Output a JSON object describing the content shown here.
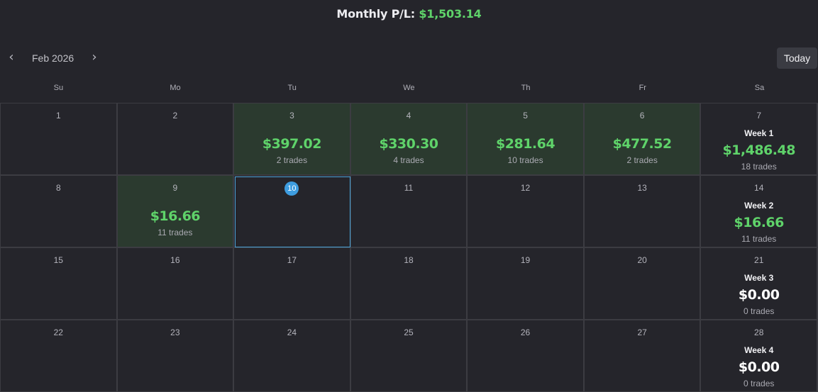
{
  "summary": {
    "label": "Monthly P/L:",
    "value": "$1,503.14"
  },
  "nav": {
    "month_label": "Feb 2026",
    "prev": "‹",
    "next": "›",
    "today_label": "Today"
  },
  "weekdays": [
    "Su",
    "Mo",
    "Tu",
    "We",
    "Th",
    "Fr",
    "Sa"
  ],
  "colors": {
    "profit_green": "#5fd36a",
    "profit_cell_bg": "#2b3a2f",
    "today_accent": "#3e9de0"
  },
  "days": [
    {
      "day": "1"
    },
    {
      "day": "2"
    },
    {
      "day": "3",
      "pnl": "$397.02",
      "trades": "2 trades"
    },
    {
      "day": "4",
      "pnl": "$330.30",
      "trades": "4 trades"
    },
    {
      "day": "5",
      "pnl": "$281.64",
      "trades": "10 trades"
    },
    {
      "day": "6",
      "pnl": "$477.52",
      "trades": "2 trades"
    },
    {
      "day": "7",
      "week": "Week 1",
      "week_pnl": "$1,486.48",
      "week_trades": "18 trades"
    },
    {
      "day": "8"
    },
    {
      "day": "9",
      "pnl": "$16.66",
      "trades": "11 trades"
    },
    {
      "day": "10",
      "today": true
    },
    {
      "day": "11"
    },
    {
      "day": "12"
    },
    {
      "day": "13"
    },
    {
      "day": "14",
      "week": "Week 2",
      "week_pnl": "$16.66",
      "week_trades": "11 trades"
    },
    {
      "day": "15"
    },
    {
      "day": "16"
    },
    {
      "day": "17"
    },
    {
      "day": "18"
    },
    {
      "day": "19"
    },
    {
      "day": "20"
    },
    {
      "day": "21",
      "week": "Week 3",
      "week_pnl": "$0.00",
      "week_trades": "0 trades"
    },
    {
      "day": "22"
    },
    {
      "day": "23"
    },
    {
      "day": "24"
    },
    {
      "day": "25"
    },
    {
      "day": "26"
    },
    {
      "day": "27"
    },
    {
      "day": "28",
      "week": "Week 4",
      "week_pnl": "$0.00",
      "week_trades": "0 trades"
    }
  ]
}
